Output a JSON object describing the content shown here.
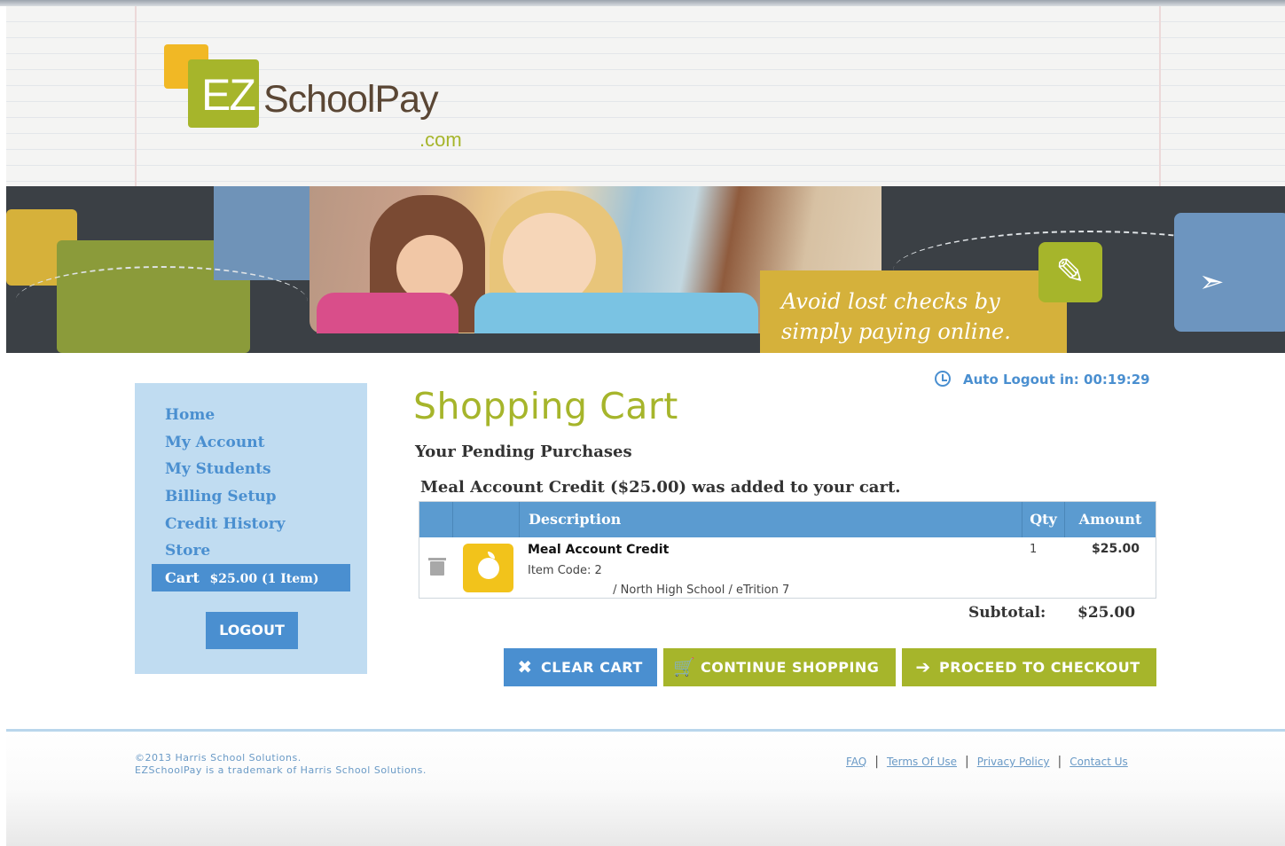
{
  "header": {
    "logo_ez": "EZ",
    "logo_name": "SchoolPay",
    "logo_tld": ".com"
  },
  "banner": {
    "tagline_line1": "Avoid lost checks by",
    "tagline_line2": "simply paying online."
  },
  "sidebar": {
    "items": [
      {
        "label": "Home"
      },
      {
        "label": "My Account"
      },
      {
        "label": "My Students"
      },
      {
        "label": "Billing Setup"
      },
      {
        "label": "Credit History"
      },
      {
        "label": "Store"
      }
    ],
    "cart_label": "Cart",
    "cart_amount": "$25.00 (1 Item)",
    "logout_label": "LOGOUT"
  },
  "session": {
    "auto_logout": "Auto Logout in: 00:19:29"
  },
  "main": {
    "title": "Shopping Cart",
    "subtitle": "Your Pending Purchases",
    "added_message": "Meal Account Credit ($25.00) was added to your cart.",
    "table": {
      "headers": {
        "description": "Description",
        "qty": "Qty",
        "amount": "Amount"
      },
      "rows": [
        {
          "name": "Meal Account Credit",
          "item_code": "Item Code: 2",
          "detail": "/ North High School / eTrition 7",
          "qty": "1",
          "amount": "$25.00"
        }
      ]
    },
    "subtotal_label": "Subtotal:",
    "subtotal_value": "$25.00",
    "buttons": {
      "clear": "CLEAR CART",
      "continue": "CONTINUE SHOPPING",
      "checkout": "PROCEED TO CHECKOUT"
    }
  },
  "footer": {
    "copyright_line1": "©2013 Harris School Solutions.",
    "copyright_line2": "EZSchoolPay is a trademark of Harris School Solutions.",
    "links": {
      "faq": "FAQ",
      "terms": "Terms Of Use",
      "privacy": "Privacy Policy",
      "contact": "Contact Us"
    }
  },
  "colors": {
    "brand_green": "#a6b52b",
    "brand_blue": "#4a8fd0",
    "sidebar_bg": "#c0dcf1",
    "accent_yellow": "#f2c31b"
  }
}
